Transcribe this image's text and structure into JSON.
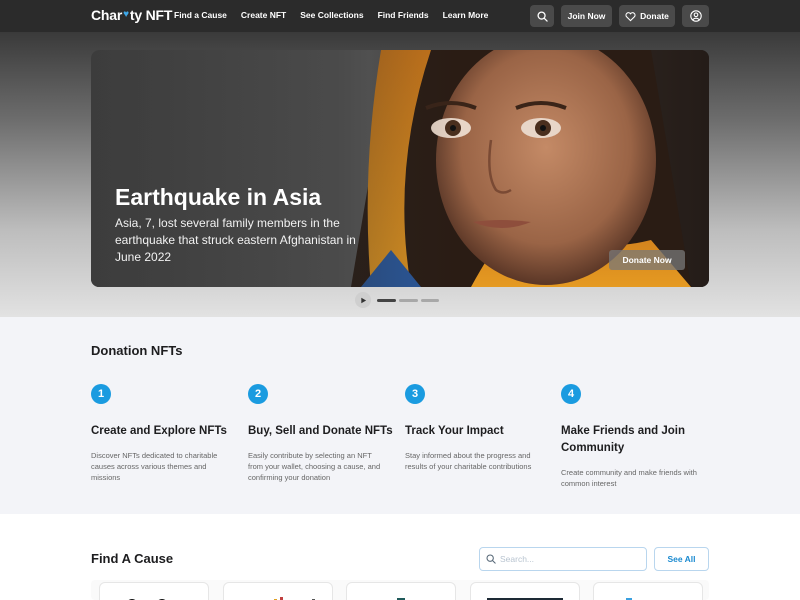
{
  "header": {
    "logo_text_before": "Char",
    "logo_text_after": "ty NFT",
    "nav": [
      "Find a Cause",
      "Create NFT",
      "See Collections",
      "Find Friends",
      "Learn More"
    ],
    "join_label": "Join Now",
    "donate_label": "Donate",
    "icons": {
      "search": "search-icon",
      "donate": "heart-hand-icon",
      "user": "user-circle-icon"
    }
  },
  "hero": {
    "title": "Earthquake in Asia",
    "description": "Asia, 7, lost several family members in the earthquake that struck eastern Afghanistan in June 2022",
    "donate_label": "Donate Now",
    "slides": 3,
    "active_slide": 1
  },
  "nfts": {
    "title": "Donation NFTs",
    "steps": [
      {
        "number": "1",
        "title": "Create and Explore NFTs",
        "description": "Discover NFTs dedicated to charitable causes across various themes and missions"
      },
      {
        "number": "2",
        "title": "Buy, Sell and Donate NFTs",
        "description": "Easily contribute by selecting an NFT from your wallet, choosing a cause, and confirming your donation"
      },
      {
        "number": "3",
        "title": "Track Your Impact",
        "description": "Stay informed about the progress and results of your charitable contributions"
      },
      {
        "number": "4",
        "title": "Make Friends and Join Community",
        "description": "Create community and make friends with common interest"
      }
    ]
  },
  "causes": {
    "title": "Find A Cause",
    "search_placeholder": "Search...",
    "see_all_label": "See All"
  },
  "colors": {
    "accent": "#1a9be0",
    "nav_bg": "#2b2b2b",
    "section_bg": "#f3f4f8"
  }
}
